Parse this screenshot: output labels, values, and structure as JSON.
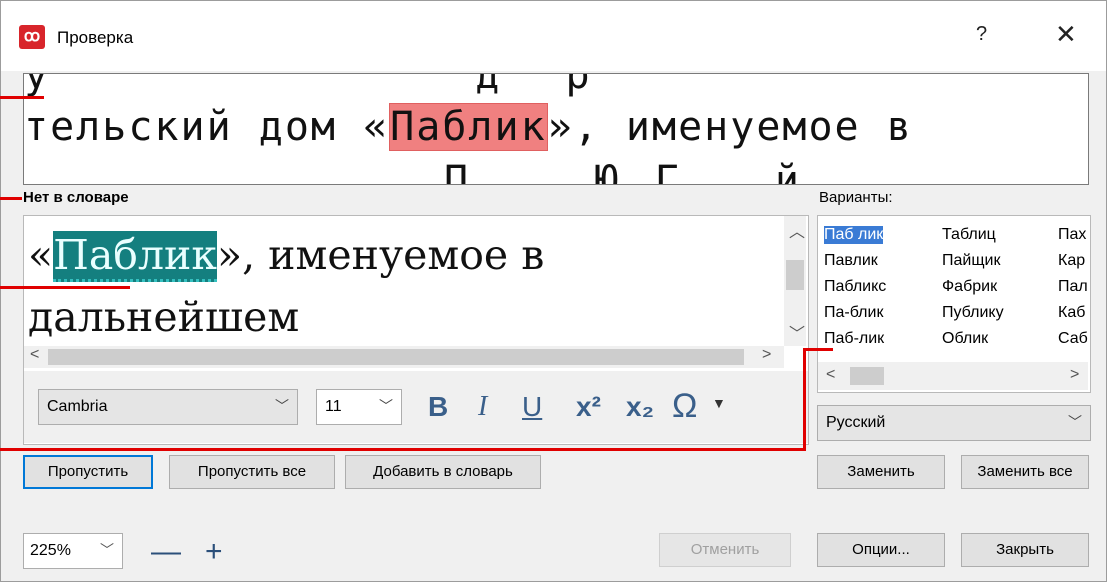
{
  "window": {
    "title": "Проверка",
    "app_icon": "abbyy-logo-icon",
    "help_label": "?",
    "close_label": "✕"
  },
  "preview": {
    "line_before": "тельский дом «",
    "highlighted_word": "Паблик",
    "line_after": "», именуемое в"
  },
  "not_in_dictionary": {
    "label": "Нет в словаре",
    "text_before": "«",
    "highlighted_word": "Паблик",
    "text_after": "», именуемое в дальнейшем"
  },
  "formatting": {
    "font_name": "Cambria",
    "font_size": "11",
    "bold": "B",
    "italic": "I",
    "underline": "U",
    "superscript": "x²",
    "subscript": "x₂",
    "special_chars": "Ω"
  },
  "variants": {
    "label": "Варианты:",
    "col1": [
      "Паб лик",
      "Павлик",
      "Пабликс",
      "Па-блик",
      "Паб-лик"
    ],
    "col2": [
      "Таблиц",
      "Пайщик",
      "Фабрик",
      "Публику",
      "Облик"
    ],
    "col3": [
      "Пах",
      "Кар",
      "Пал",
      "Каб",
      "Саб"
    ],
    "selected": "Паб лик"
  },
  "language": {
    "selected": "Русский"
  },
  "buttons": {
    "skip": "Пропустить",
    "skip_all": "Пропустить все",
    "add_to_dictionary": "Добавить в словарь",
    "replace": "Заменить",
    "replace_all": "Заменить все",
    "cancel": "Отменить",
    "options": "Опции...",
    "close": "Закрыть"
  },
  "zoom": {
    "value": "225%",
    "minus": "—",
    "plus": "+"
  },
  "colors": {
    "preview_highlight": "#f08080",
    "error_highlight": "#147f7f",
    "annotation_line": "#e00000",
    "selection": "#3a7bd5"
  }
}
